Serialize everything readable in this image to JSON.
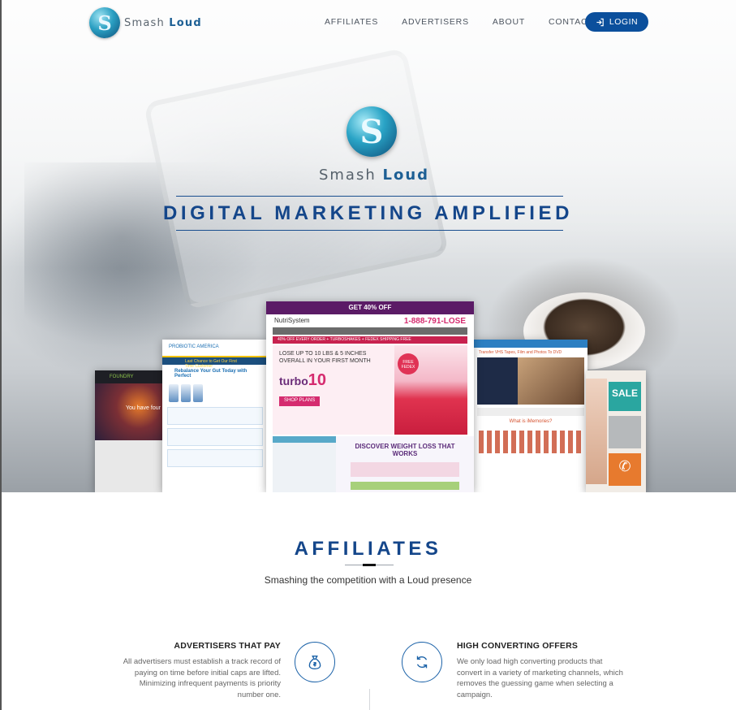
{
  "nav": {
    "brand": {
      "word1": "Smash",
      "word2": "Loud"
    },
    "links": [
      {
        "label": "AFFILIATES"
      },
      {
        "label": "ADVERTISERS"
      },
      {
        "label": "ABOUT"
      },
      {
        "label": "CONTACT"
      }
    ],
    "login_label": "LOGIN"
  },
  "hero": {
    "brand": {
      "word1": "Smash",
      "word2": "Loud"
    },
    "tagline": "DIGITAL MARKETING AMPLIFIED",
    "collage": {
      "left_site_text": "You have four",
      "probiotic_banner": "Last Chance to Get Our First Time Customer",
      "probiotic_heading": "Rebalance Your Gut Today with Perfect",
      "nutri_top": "GET 40% OFF",
      "nutri_brand": "NutriSystem",
      "nutri_phone": "1-888-791-LOSE",
      "nutri_promo": "40% OFF EVERY ORDER + TURBOSHAKES + FEDEX SHIPPING FREE",
      "nutri_headline": "LOSE UP TO 10 LBS & 5 INCHES OVERALL IN YOUR FIRST MONTH",
      "nutri_turbo": "turbo",
      "nutri_turbo_num": "10",
      "nutri_shop": "SHOP PLANS",
      "nutri_fedex": "FREE FEDEX",
      "nutri_discover": "DISCOVER WEIGHT LOSS THAT WORKS",
      "memories_title": "Transfer VHS Tapes, Film and Photos To DVD",
      "memories_question": "What is iMemories?",
      "sale_label": "SALE"
    },
    "colors": {
      "brand_blue": "#14468a",
      "login_blue": "#0b4f9c"
    }
  },
  "affiliates": {
    "title": "AFFILIATES",
    "subtitle": "Smashing the competition with a Loud presence",
    "features": [
      {
        "title": "ADVERTISERS THAT PAY",
        "text": "All advertisers must establish a track record of paying on time before initial caps are lifted. Minimizing infrequent payments is priority number one.",
        "icon": "money-bag-icon"
      },
      {
        "title": "HIGH CONVERTING OFFERS",
        "text": "We only load high converting products that convert in a variety of marketing channels, which removes the guessing game when selecting a campaign.",
        "icon": "refresh-icon"
      }
    ]
  }
}
